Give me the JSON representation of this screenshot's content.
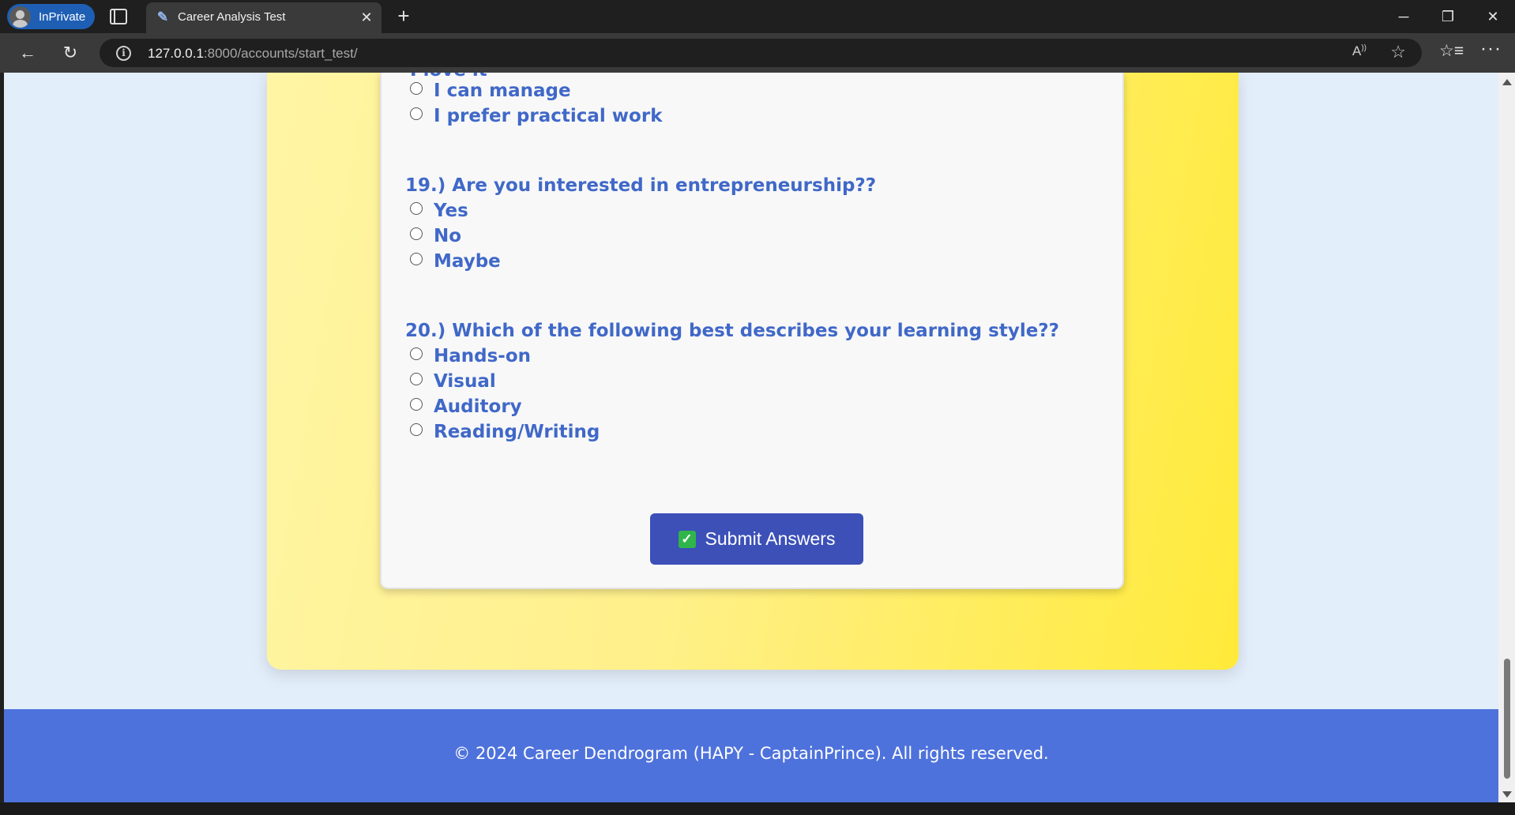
{
  "browser": {
    "inprivate_label": "InPrivate",
    "tab_title": "Career Analysis Test",
    "url_host": "127.0.0.1",
    "url_rest": ":8000/accounts/start_test/"
  },
  "quiz": {
    "partial_previous_option": "I love it",
    "q18_options": [
      "I can manage",
      "I prefer practical work"
    ],
    "q19": {
      "title": "19.) Are you interested in entrepreneurship??",
      "options": [
        "Yes",
        "No",
        "Maybe"
      ]
    },
    "q20": {
      "title": "20.) Which of the following best describes your learning style??",
      "options": [
        "Hands-on",
        "Visual",
        "Auditory",
        "Reading/Writing"
      ]
    },
    "submit_label": "Submit Answers"
  },
  "footer": {
    "text": "© 2024 Career Dendrogram (HAPY - CaptainPrince). All rights reserved."
  },
  "colors": {
    "accent_blue": "#4068c8",
    "button": "#3c50b8",
    "footer": "#4e72dc",
    "check": "#2fb54a"
  }
}
